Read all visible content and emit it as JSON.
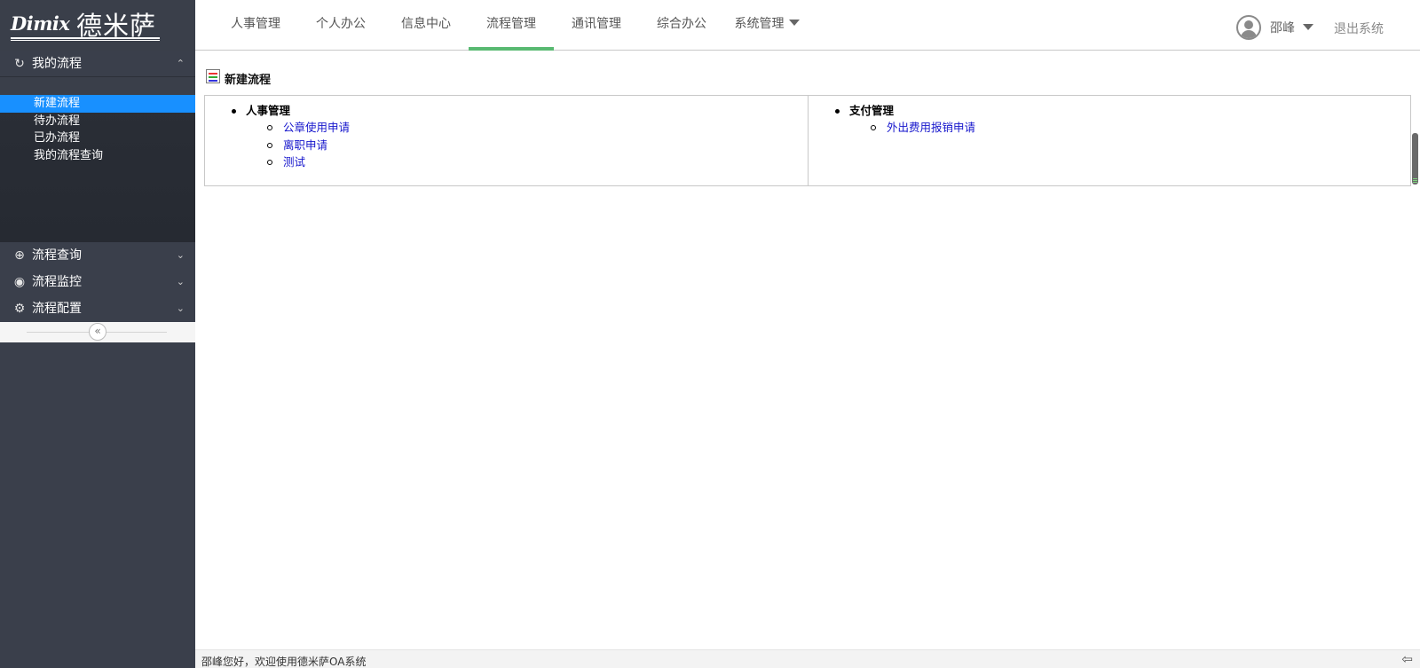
{
  "brand": {
    "latin": "Dimix",
    "chinese": "德米萨"
  },
  "nav": {
    "tabs": [
      {
        "label": "人事管理"
      },
      {
        "label": "个人办公"
      },
      {
        "label": "信息中心"
      },
      {
        "label": "流程管理",
        "active": true
      },
      {
        "label": "通讯管理"
      },
      {
        "label": "综合办公"
      },
      {
        "label": "系统管理",
        "has_dropdown": true
      }
    ],
    "active_indicator_color": "#58b971"
  },
  "user": {
    "name": "邵峰",
    "logout_label": "退出系统"
  },
  "sidebar": {
    "sections": [
      {
        "label": "我的流程",
        "icon": "refresh-icon",
        "expanded": true
      },
      {
        "label": "流程查询",
        "icon": "search-icon",
        "expanded": false
      },
      {
        "label": "流程监控",
        "icon": "eye-icon",
        "expanded": false
      },
      {
        "label": "流程配置",
        "icon": "gear-icon",
        "expanded": false
      }
    ],
    "my_flow_items": [
      {
        "label": "新建流程",
        "active": true
      },
      {
        "label": "待办流程"
      },
      {
        "label": "已办流程"
      },
      {
        "label": "我的流程查询"
      }
    ],
    "active_color": "#1890ff"
  },
  "content": {
    "title": "新建流程",
    "groups": [
      {
        "title": "人事管理",
        "links": [
          "公章使用申请",
          "离职申请",
          "测试"
        ]
      },
      {
        "title": "支付管理",
        "links": [
          "外出费用报销申请"
        ]
      }
    ]
  },
  "footer": {
    "welcome": "邵峰您好，欢迎使用德米萨OA系统"
  }
}
